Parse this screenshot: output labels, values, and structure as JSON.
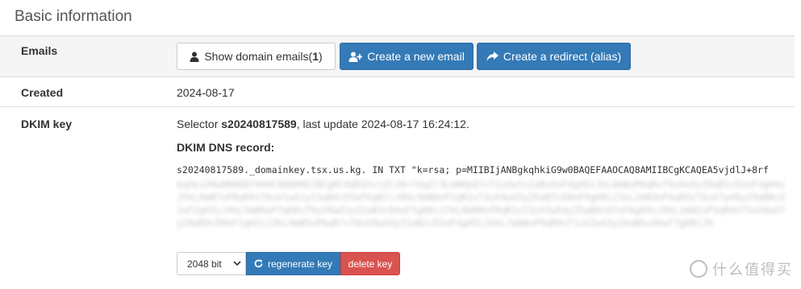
{
  "page": {
    "title": "Basic information"
  },
  "emails": {
    "label": "Emails",
    "show_button": "Show domain emails",
    "show_count_open": " (",
    "show_count": "1",
    "show_count_close": ")",
    "create_button": "Create a new email",
    "redirect_button": "Create a redirect (alias)"
  },
  "created": {
    "label": "Created",
    "value": "2024-08-17"
  },
  "dkim": {
    "label": "DKIM key",
    "selector_prefix": "Selector ",
    "selector": "s20240817589",
    "selector_suffix": ", last update 2024-08-17 16:24:12.",
    "dns_heading": "DKIM DNS record:",
    "dns_record": "s20240817589._domainkey.tsx.us.kg. IN TXT \"k=rsa; p=MIIBIjANBgkqhkiG9w0BAQEFAAOCAQ8AMIIBCgKCAQEA5vjdlJ+8rf",
    "key_size": "2048 bit",
    "regenerate_button": "regenerate key",
    "delete_button": "delete key"
  },
  "watermark": {
    "text": "什么值得买"
  },
  "colors": {
    "primary": "#337ab7",
    "danger": "#d9534f",
    "row_alt": "#f5f5f5"
  }
}
